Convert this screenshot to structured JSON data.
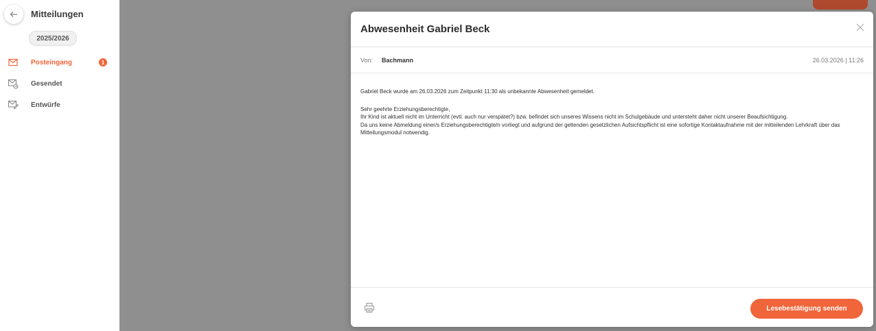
{
  "sidebar": {
    "title": "Mitteilungen",
    "school_year": "2025/2026",
    "items": [
      {
        "label": "Posteingang",
        "badge": "1",
        "icon": "envelope-icon",
        "active": true
      },
      {
        "label": "Gesendet",
        "icon": "sent-mail-icon"
      },
      {
        "label": "Entwürfe",
        "icon": "draft-mail-icon"
      }
    ]
  },
  "modal": {
    "title": "Abwesenheit Gabriel Beck",
    "from_label": "Von:",
    "from_value": "Bachmann",
    "datetime": "26.03.2026 | 11:26",
    "paragraphs": [
      "Gabriel Beck wurde am 26.03.2026 zum Zeitpunkt 11:30 als unbekannte Abwesenheit gemeldet.",
      "Sehr geehrte Erziehungsberechtigte,",
      "Ihr Kind ist aktuell nicht im Unterricht (evtl. auch nur verspätet?) bzw. befindet sich unseres Wissens nicht im Schulgebäude und untersteht daher nicht unserer Beaufsichtigung.",
      "Da uns keine Abmeldung einer/s Erziehungsberechtigte/n vorliegt und aufgrund der geltenden gesetzlichen Aufsichtspflicht ist eine sofortige Kontaktaufnahme mit der mitteilenden Lehrkraft über das Mitteilungsmodul notwendig."
    ],
    "confirm_button": "Lesebestätigung senden"
  },
  "colors": {
    "accent": "#f0653a",
    "overlay": "#8f8f8f"
  }
}
